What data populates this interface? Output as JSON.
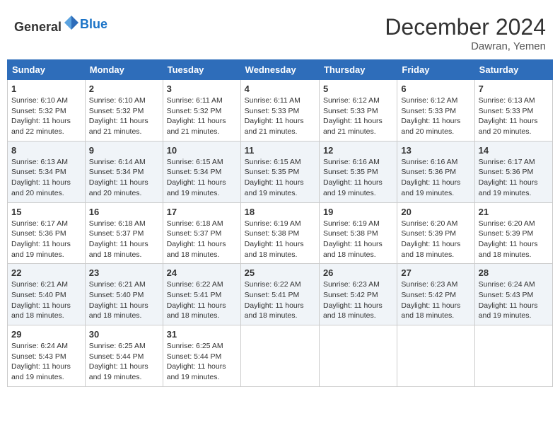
{
  "header": {
    "logo_general": "General",
    "logo_blue": "Blue",
    "month": "December 2024",
    "location": "Dawran, Yemen"
  },
  "weekdays": [
    "Sunday",
    "Monday",
    "Tuesday",
    "Wednesday",
    "Thursday",
    "Friday",
    "Saturday"
  ],
  "weeks": [
    [
      {
        "day": "1",
        "sunrise": "6:10 AM",
        "sunset": "5:32 PM",
        "daylight": "11 hours and 22 minutes."
      },
      {
        "day": "2",
        "sunrise": "6:10 AM",
        "sunset": "5:32 PM",
        "daylight": "11 hours and 21 minutes."
      },
      {
        "day": "3",
        "sunrise": "6:11 AM",
        "sunset": "5:32 PM",
        "daylight": "11 hours and 21 minutes."
      },
      {
        "day": "4",
        "sunrise": "6:11 AM",
        "sunset": "5:33 PM",
        "daylight": "11 hours and 21 minutes."
      },
      {
        "day": "5",
        "sunrise": "6:12 AM",
        "sunset": "5:33 PM",
        "daylight": "11 hours and 21 minutes."
      },
      {
        "day": "6",
        "sunrise": "6:12 AM",
        "sunset": "5:33 PM",
        "daylight": "11 hours and 20 minutes."
      },
      {
        "day": "7",
        "sunrise": "6:13 AM",
        "sunset": "5:33 PM",
        "daylight": "11 hours and 20 minutes."
      }
    ],
    [
      {
        "day": "8",
        "sunrise": "6:13 AM",
        "sunset": "5:34 PM",
        "daylight": "11 hours and 20 minutes."
      },
      {
        "day": "9",
        "sunrise": "6:14 AM",
        "sunset": "5:34 PM",
        "daylight": "11 hours and 20 minutes."
      },
      {
        "day": "10",
        "sunrise": "6:15 AM",
        "sunset": "5:34 PM",
        "daylight": "11 hours and 19 minutes."
      },
      {
        "day": "11",
        "sunrise": "6:15 AM",
        "sunset": "5:35 PM",
        "daylight": "11 hours and 19 minutes."
      },
      {
        "day": "12",
        "sunrise": "6:16 AM",
        "sunset": "5:35 PM",
        "daylight": "11 hours and 19 minutes."
      },
      {
        "day": "13",
        "sunrise": "6:16 AM",
        "sunset": "5:36 PM",
        "daylight": "11 hours and 19 minutes."
      },
      {
        "day": "14",
        "sunrise": "6:17 AM",
        "sunset": "5:36 PM",
        "daylight": "11 hours and 19 minutes."
      }
    ],
    [
      {
        "day": "15",
        "sunrise": "6:17 AM",
        "sunset": "5:36 PM",
        "daylight": "11 hours and 19 minutes."
      },
      {
        "day": "16",
        "sunrise": "6:18 AM",
        "sunset": "5:37 PM",
        "daylight": "11 hours and 18 minutes."
      },
      {
        "day": "17",
        "sunrise": "6:18 AM",
        "sunset": "5:37 PM",
        "daylight": "11 hours and 18 minutes."
      },
      {
        "day": "18",
        "sunrise": "6:19 AM",
        "sunset": "5:38 PM",
        "daylight": "11 hours and 18 minutes."
      },
      {
        "day": "19",
        "sunrise": "6:19 AM",
        "sunset": "5:38 PM",
        "daylight": "11 hours and 18 minutes."
      },
      {
        "day": "20",
        "sunrise": "6:20 AM",
        "sunset": "5:39 PM",
        "daylight": "11 hours and 18 minutes."
      },
      {
        "day": "21",
        "sunrise": "6:20 AM",
        "sunset": "5:39 PM",
        "daylight": "11 hours and 18 minutes."
      }
    ],
    [
      {
        "day": "22",
        "sunrise": "6:21 AM",
        "sunset": "5:40 PM",
        "daylight": "11 hours and 18 minutes."
      },
      {
        "day": "23",
        "sunrise": "6:21 AM",
        "sunset": "5:40 PM",
        "daylight": "11 hours and 18 minutes."
      },
      {
        "day": "24",
        "sunrise": "6:22 AM",
        "sunset": "5:41 PM",
        "daylight": "11 hours and 18 minutes."
      },
      {
        "day": "25",
        "sunrise": "6:22 AM",
        "sunset": "5:41 PM",
        "daylight": "11 hours and 18 minutes."
      },
      {
        "day": "26",
        "sunrise": "6:23 AM",
        "sunset": "5:42 PM",
        "daylight": "11 hours and 18 minutes."
      },
      {
        "day": "27",
        "sunrise": "6:23 AM",
        "sunset": "5:42 PM",
        "daylight": "11 hours and 18 minutes."
      },
      {
        "day": "28",
        "sunrise": "6:24 AM",
        "sunset": "5:43 PM",
        "daylight": "11 hours and 19 minutes."
      }
    ],
    [
      {
        "day": "29",
        "sunrise": "6:24 AM",
        "sunset": "5:43 PM",
        "daylight": "11 hours and 19 minutes."
      },
      {
        "day": "30",
        "sunrise": "6:25 AM",
        "sunset": "5:44 PM",
        "daylight": "11 hours and 19 minutes."
      },
      {
        "day": "31",
        "sunrise": "6:25 AM",
        "sunset": "5:44 PM",
        "daylight": "11 hours and 19 minutes."
      },
      null,
      null,
      null,
      null
    ]
  ]
}
